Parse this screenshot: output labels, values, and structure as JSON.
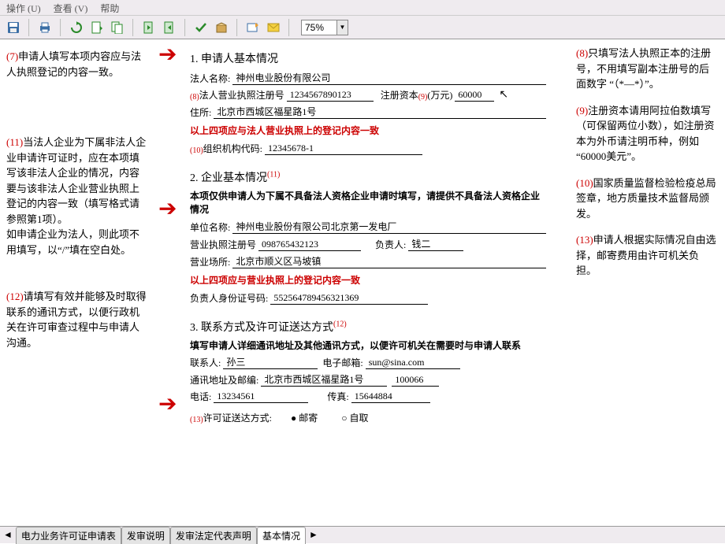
{
  "menu": {
    "action": "操作 (U)",
    "view": "查看 (V)",
    "help": "帮助"
  },
  "zoom": "75%",
  "left": {
    "n7": {
      "num": "(7)",
      "text": "申请人填写本项内容应与法人执照登记的内容一致。"
    },
    "n11": {
      "num": "(11)",
      "text": "当法人企业为下属非法人企业申请许可证时，应在本项填写该非法人企业的情况，内容要与该非法人企业营业执照上登记的内容一致（填写格式请参照第1项）。",
      "text2": "如申请企业为法人，则此项不用填写，以“/”填在空白处。"
    },
    "n12": {
      "num": "(12)",
      "text": "请填写有效并能够及时取得联系的通讯方式，以便行政机关在许可审查过程中与申请人沟通。"
    }
  },
  "right": {
    "n8": {
      "num": "(8)",
      "text": "只填写法人执照正本的注册号，不用填写副本注册号的后面数字 “（*—*）”。"
    },
    "n9": {
      "num": "(9)",
      "text": "注册资本请用阿拉伯数填写（可保留两位小数），如注册资本为外币请注明币种，例如 “60000美元”。"
    },
    "n10": {
      "num": "(10)",
      "text": "国家质量监督检验检疫总局签章，地方质量技术监督局颁发。"
    },
    "n13": {
      "num": "(13)",
      "text": "申请人根据实际情况自由选择，邮寄费用由许可机关负担。"
    }
  },
  "form": {
    "s1": {
      "title": "1. 申请人基本情况",
      "legal_name_lbl": "法人名称:",
      "legal_name": "神州电业股份有限公司",
      "license_lbl": "法人营业执照注册号",
      "license": "1234567890123",
      "capital_lbl": "注册资本",
      "capital_unit": "(万元)",
      "capital": "60000",
      "addr_lbl": "住所:",
      "addr": "北京市西城区福星路1号",
      "tip": "以上四项应与法人营业执照上的登记内容一致",
      "org_lbl": "组织机构代码:",
      "org": "12345678-1"
    },
    "s2": {
      "title": "2. 企业基本情况",
      "intro": "本项仅供申请人为下属不具备法人资格企业申请时填写，请提供不具备法人资格企业情况",
      "unit_lbl": "单位名称:",
      "unit": "神州电业股份有限公司北京第一发电厂",
      "license_lbl": "营业执照注册号",
      "license": "098765432123",
      "person_lbl": "负责人:",
      "person": "钱二",
      "place_lbl": "营业场所:",
      "place": "北京市顺义区马坡镇",
      "tip": "以上四项应与营业执照上的登记内容一致",
      "id_lbl": "负责人身份证号码:",
      "id": "552564789456321369"
    },
    "s3": {
      "title": "3. 联系方式及许可证送达方式",
      "intro": "填写申请人详细通讯地址及其他通讯方式，以便许可机关在需要时与申请人联系",
      "contact_lbl": "联系人:",
      "contact": "孙三",
      "email_lbl": "电子邮箱:",
      "email": "sun@sina.com",
      "mail_lbl": "通讯地址及邮编:",
      "mail": "北京市西城区福星路1号",
      "zip": "100066",
      "tel_lbl": "电话:",
      "tel": "13234561",
      "fax_lbl": "传真:",
      "fax": "15644884",
      "delivery_lbl": "许可证送达方式:",
      "opt1": "邮寄",
      "opt2": "自取"
    }
  },
  "tabs": {
    "t1": "电力业务许可证申请表",
    "t2": "发审说明",
    "t3": "发审法定代表声明",
    "t4": "基本情况"
  }
}
